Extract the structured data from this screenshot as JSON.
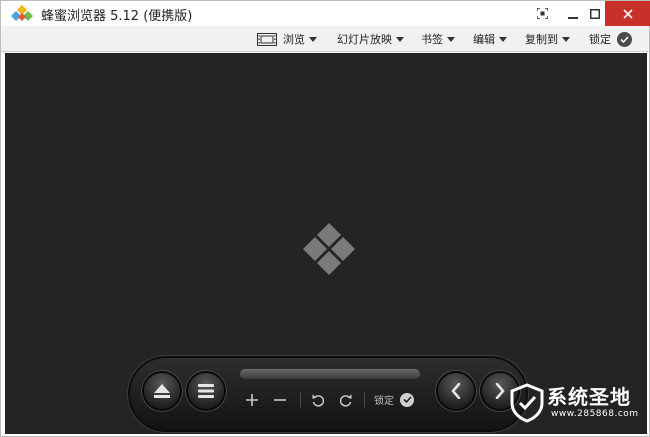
{
  "window": {
    "title": "蜂蜜浏览器 5.12 (便携版)",
    "app_icon": "honeyview-logo-icon",
    "controls": {
      "fullscreen_icon": "fullscreen-icon",
      "minimize_icon": "minimize-icon",
      "maximize_icon": "maximize-icon",
      "close_icon": "close-icon",
      "close_color": "#c7312a"
    }
  },
  "toolbar": {
    "browse_label": "浏览",
    "browse_icon": "filmstrip-icon",
    "slideshow_label": "幻灯片放映",
    "bookmarks_label": "书签",
    "edit_label": "编辑",
    "copyto_label": "复制到",
    "lock_label": "锁定",
    "lock_icon": "check-circle-icon"
  },
  "viewer": {
    "background_color": "#242424",
    "placeholder_icon": "honeyview-diamond-icon"
  },
  "control_bar": {
    "eject_icon": "eject-icon",
    "menu_icon": "menu-icon",
    "zoom_in_icon": "plus-icon",
    "zoom_out_icon": "minus-icon",
    "rotate_left_icon": "rotate-left-icon",
    "rotate_right_icon": "rotate-right-icon",
    "lock_label": "锁定",
    "lock_icon": "check-circle-icon",
    "prev_icon": "chevron-left-icon",
    "next_icon": "chevron-right-icon"
  },
  "watermark": {
    "text": "系统圣地",
    "url": "www.285868.com",
    "icon": "shield-icon"
  }
}
